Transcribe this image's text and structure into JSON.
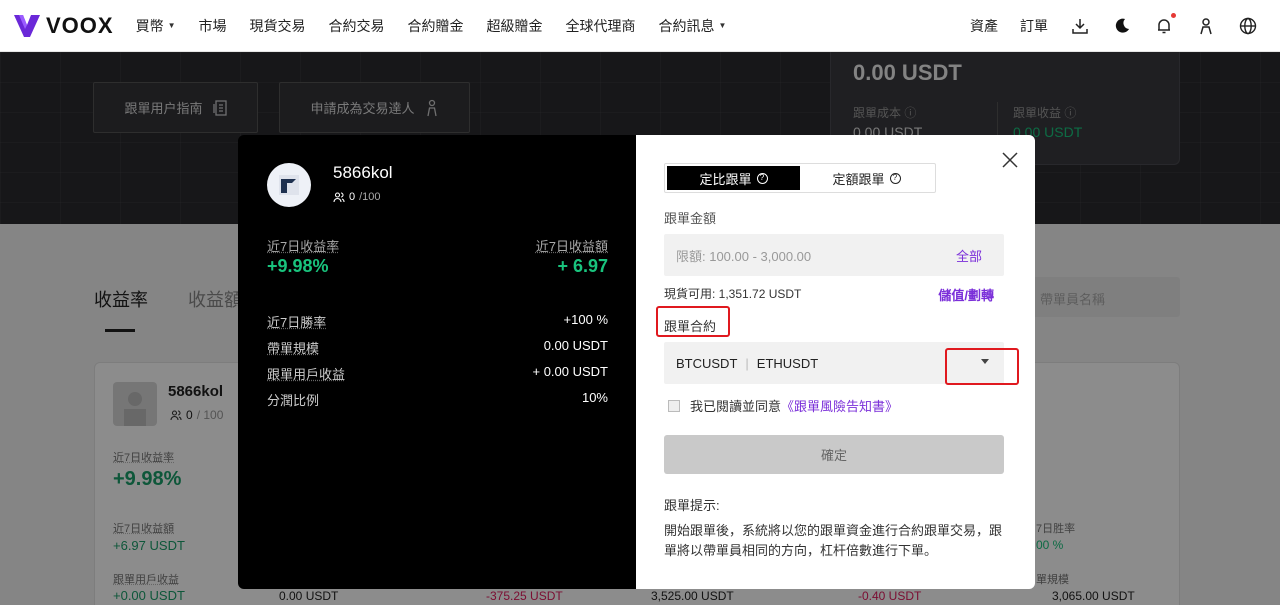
{
  "nav": {
    "logo": "VOOX",
    "items": [
      {
        "label": "買幣",
        "dropdown": true
      },
      {
        "label": "市場",
        "dropdown": false
      },
      {
        "label": "現貨交易",
        "dropdown": false
      },
      {
        "label": "合約交易",
        "dropdown": false
      },
      {
        "label": "合約贈金",
        "dropdown": false
      },
      {
        "label": "超級贈金",
        "dropdown": false
      },
      {
        "label": "全球代理商",
        "dropdown": false
      },
      {
        "label": "合約訊息",
        "dropdown": true
      }
    ],
    "assets": "資產",
    "orders": "訂單",
    "icons": [
      "download-icon",
      "moon-icon",
      "bell-icon",
      "user-icon",
      "globe-icon"
    ]
  },
  "hero": {
    "guide_button": "跟單用户指南",
    "apply_button": "申請成為交易達人",
    "total": "0.00 USDT",
    "cost_label": "跟單成本",
    "cost_value": "0.00 USDT",
    "profit_label": "跟單收益",
    "profit_value": "0.00 USDT"
  },
  "background": {
    "tab_active": "收益率",
    "tab_other": "收益額",
    "search_placeholder": "帶單員名稱",
    "trader_name": "5866kol",
    "count": "0",
    "max": "/ 100",
    "roi_label": "近7日收益率",
    "roi_value": "+9.98%",
    "pnl_label": "近7日收益額",
    "pnl_value": "+6.97 USDT",
    "follower_label": "跟單用戶收益",
    "follower_value": "+0.00 USDT",
    "col_values": [
      "0.00 USDT",
      "-375.25 USDT",
      "3,525.00 USDT",
      "-0.40 USDT",
      "3,065.00 USDT"
    ],
    "right_labels": [
      "7日胜率",
      "00 %",
      "單規模"
    ]
  },
  "modal": {
    "trader": {
      "name": "5866kol",
      "count": "0",
      "max": "/100",
      "roi_label": "近7日收益率",
      "roi_value": "+9.98%",
      "pnl_label": "近7日收益額",
      "pnl_value": "+ 6.97"
    },
    "stats": [
      {
        "label": "近7日勝率",
        "value": "+100 %"
      },
      {
        "label": "帶單規模",
        "value": "0.00 USDT"
      },
      {
        "label": "跟單用戶收益",
        "value": "+ 0.00 USDT"
      },
      {
        "label": "分潤比例",
        "value": "10%"
      }
    ],
    "mode_tabs": [
      {
        "label": "定比跟單",
        "active": true
      },
      {
        "label": "定額跟單",
        "active": false
      }
    ],
    "amount_label": "跟單金額",
    "amount_placeholder": "限額: 100.00 - 3,000.00",
    "amount_all": "全部",
    "available": "現貨可用: 1,351.72 USDT",
    "deposit_link": "儲值/劃轉",
    "contract_label": "跟單合約",
    "contracts": [
      "BTCUSDT",
      "ETHUSDT"
    ],
    "agree_text": "我已閱讀並同意",
    "agree_doc": "《跟單風險告知書》",
    "confirm": "確定",
    "tip_title": "跟單提示:",
    "tip_body": "開始跟單後，系統將以您的跟單資金進行合約跟單交易，跟單將以帶單員相同的方向，杠杆倍數進行下單。"
  },
  "colors": {
    "accent": "#7b2fd9",
    "positive": "#19c37d",
    "negative": "#e0195c",
    "highlight": "#e0191f"
  }
}
